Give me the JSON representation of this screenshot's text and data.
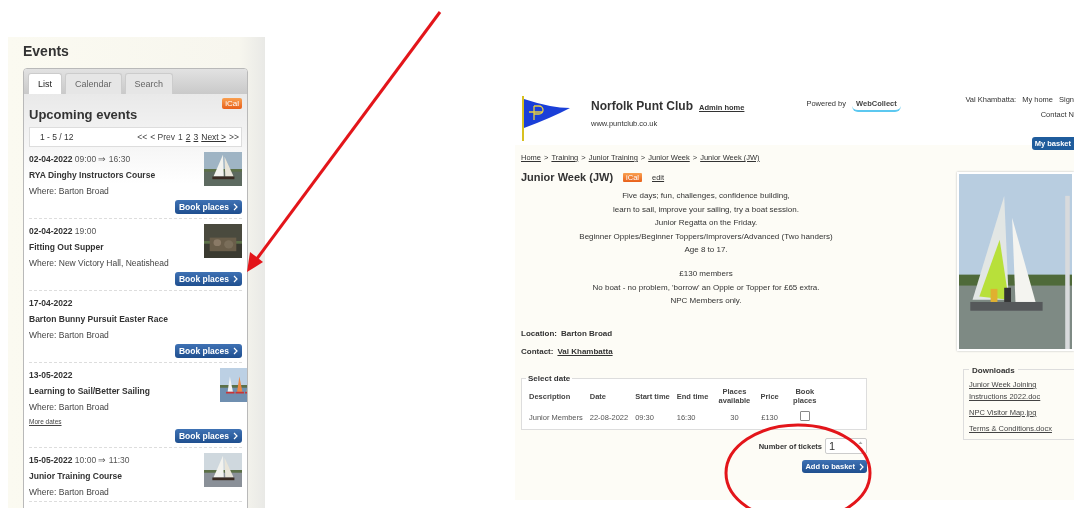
{
  "events_panel": {
    "title": "Events",
    "tabs": [
      {
        "label": "List",
        "selected": true
      },
      {
        "label": "Calendar",
        "selected": false
      },
      {
        "label": "Search",
        "selected": false
      }
    ],
    "heading": "Upcoming events",
    "ical_badge": "iCal",
    "pager": {
      "range": "1 - 5 / 12",
      "first": "<<",
      "prev": "< Prev",
      "pages": [
        {
          "label": "1",
          "selected": true
        },
        {
          "label": "2",
          "selected": false
        },
        {
          "label": "3",
          "selected": false
        }
      ],
      "next": "Next >",
      "last": ">>"
    },
    "events": [
      {
        "date": "02-04-2022",
        "time": "09:00 ⇒ 16:30",
        "title": "RYA Dinghy Instructors Course",
        "where": "Where: Barton Broad",
        "picture": true,
        "button": "Book places"
      },
      {
        "date": "02-04-2022",
        "time": "19:00",
        "title": "Fitting Out Supper",
        "where": "Where: New Victory Hall, Neatishead",
        "picture": true,
        "button": "Book places"
      },
      {
        "date": "17-04-2022",
        "title": "Barton Bunny Pursuit Easter Race",
        "where": "Where: Barton Broad",
        "picture": false,
        "button": "Book places"
      },
      {
        "date": "13-05-2022",
        "title": "Learning to Sail/Better Sailing",
        "where": "Where: Barton Broad",
        "more_dates": "More dates",
        "picture": true,
        "button": "Book places"
      },
      {
        "date": "15-05-2022",
        "time": "10:00 ⇒ 11:30",
        "title": "Junior Training Course",
        "where": "Where: Barton Broad",
        "picture": true
      }
    ]
  },
  "event_page": {
    "club_name": "Norfolk Punt Club",
    "admin_link": "Admin home",
    "url": "www.puntclub.co.uk",
    "powered_by": "Powered by",
    "brand": "WebCollect",
    "user_name": "Val Khambatta:",
    "user_links": [
      "My home",
      "Sign"
    ],
    "contact_link": "Contact N",
    "basket_button": "My basket",
    "breadcrumb": [
      "Home",
      "Training",
      "Junior Training",
      "Junior Week",
      "Junior Week (JW)"
    ],
    "breadcrumb_separator": ">",
    "title": "Junior Week (JW)",
    "ical_badge": "iCal",
    "edit_link": "edit",
    "description": [
      [
        "Five days; fun, challenges, confidence building,",
        "learn to sail, improve your sailing, try a boat session.",
        "Junior Regatta on the Friday.",
        "Beginner Oppies/Beginner Toppers/Improvers/Advanced (Two handers)",
        "Age 8 to 17."
      ],
      [
        "£130 members",
        "No boat - no problem, 'borrow' an Oppie or Topper for £65 extra.",
        "NPC Members only."
      ]
    ],
    "location_label": "Location:",
    "location": "Barton Broad",
    "contact_label": "Contact:",
    "contact": "Val Khambatta",
    "dates": {
      "legend": "Select date",
      "columns": [
        "Description",
        "Date",
        "Start time",
        "End time",
        "Places available",
        "Price",
        "Book places"
      ],
      "rows": [
        {
          "cells": [
            "Junior Members",
            "22-08-2022",
            "09:30",
            "16:30",
            "30",
            "£130"
          ],
          "checked": false
        }
      ]
    },
    "tickets_label": "Number of tickets",
    "tickets": "1",
    "add_button": "Add to basket",
    "downloads": {
      "title": "Downloads",
      "items": [
        "Junior Week Joining Instructions 2022.doc",
        "NPC Visitor Map.jpg",
        "Terms & Conditions.docx"
      ]
    }
  }
}
